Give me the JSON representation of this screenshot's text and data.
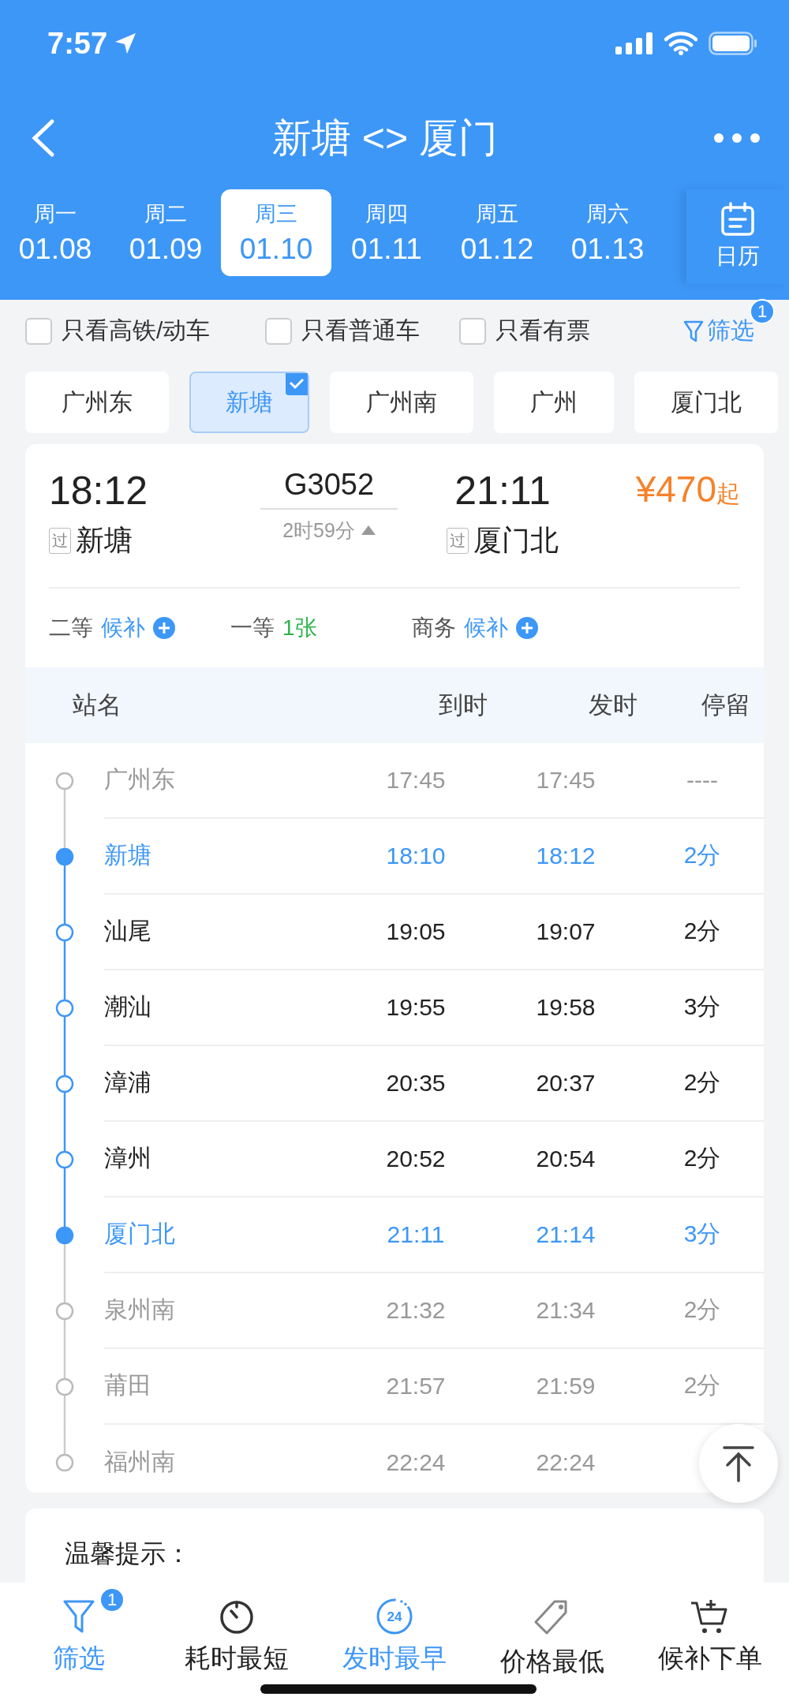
{
  "status_bar": {
    "time": "7:57"
  },
  "header": {
    "title": "新塘 <> 厦门"
  },
  "dates": [
    {
      "weekday": "周一",
      "date": "01.08",
      "selected": false
    },
    {
      "weekday": "周二",
      "date": "01.09",
      "selected": false
    },
    {
      "weekday": "周三",
      "date": "01.10",
      "selected": true
    },
    {
      "weekday": "周四",
      "date": "01.11",
      "selected": false
    },
    {
      "weekday": "周五",
      "date": "01.12",
      "selected": false
    },
    {
      "weekday": "周六",
      "date": "01.13",
      "selected": false
    }
  ],
  "calendar_button": "日历",
  "filters": [
    {
      "label": "只看高铁/动车",
      "checked": false
    },
    {
      "label": "只看普通车",
      "checked": false
    },
    {
      "label": "只看有票",
      "checked": false
    }
  ],
  "filter_button": {
    "label": "筛选",
    "badge": "1"
  },
  "stations": [
    {
      "name": "广州东",
      "selected": false
    },
    {
      "name": "新塘",
      "selected": true
    },
    {
      "name": "广州南",
      "selected": false
    },
    {
      "name": "广州",
      "selected": false
    },
    {
      "name": "厦门北",
      "selected": false
    }
  ],
  "train": {
    "depart_time": "18:12",
    "depart_tag": "过",
    "depart_station": "新塘",
    "number": "G3052",
    "duration": "2时59分",
    "arrive_time": "21:11",
    "arrive_tag": "过",
    "arrive_station": "厦门北",
    "price": "¥470",
    "price_suffix": "起",
    "seats": [
      {
        "class": "二等",
        "status": "候补",
        "kind": "waitlist"
      },
      {
        "class": "一等",
        "status": "1张",
        "kind": "available"
      },
      {
        "class": "商务",
        "status": "候补",
        "kind": "waitlist"
      }
    ]
  },
  "stops_table": {
    "columns": [
      "站名",
      "到时",
      "发时",
      "停留"
    ],
    "rows": [
      {
        "station": "广州东",
        "arrive": "17:45",
        "depart": "17:45",
        "stop": "----",
        "kind": "outside"
      },
      {
        "station": "新塘",
        "arrive": "18:10",
        "depart": "18:12",
        "stop": "2分",
        "kind": "endpoint"
      },
      {
        "station": "汕尾",
        "arrive": "19:05",
        "depart": "19:07",
        "stop": "2分",
        "kind": "inside"
      },
      {
        "station": "潮汕",
        "arrive": "19:55",
        "depart": "19:58",
        "stop": "3分",
        "kind": "inside"
      },
      {
        "station": "漳浦",
        "arrive": "20:35",
        "depart": "20:37",
        "stop": "2分",
        "kind": "inside"
      },
      {
        "station": "漳州",
        "arrive": "20:52",
        "depart": "20:54",
        "stop": "2分",
        "kind": "inside"
      },
      {
        "station": "厦门北",
        "arrive": "21:11",
        "depart": "21:14",
        "stop": "3分",
        "kind": "endpoint"
      },
      {
        "station": "泉州南",
        "arrive": "21:32",
        "depart": "21:34",
        "stop": "2分",
        "kind": "outside"
      },
      {
        "station": "莆田",
        "arrive": "21:57",
        "depart": "21:59",
        "stop": "2分",
        "kind": "outside"
      },
      {
        "station": "福州南",
        "arrive": "22:24",
        "depart": "22:24",
        "kind": "outside"
      }
    ]
  },
  "tips": {
    "title": "温馨提示："
  },
  "tab_bar": [
    {
      "label": "筛选",
      "kind": "filter",
      "badge": "1",
      "selected": true
    },
    {
      "label": "耗时最短",
      "kind": "timer",
      "selected": false
    },
    {
      "label": "发时最早",
      "kind": "clock24",
      "icon_text": "24",
      "selected": true
    },
    {
      "label": "价格最低",
      "kind": "tag",
      "selected": false
    },
    {
      "label": "候补下单",
      "kind": "cart",
      "selected": false
    }
  ]
}
